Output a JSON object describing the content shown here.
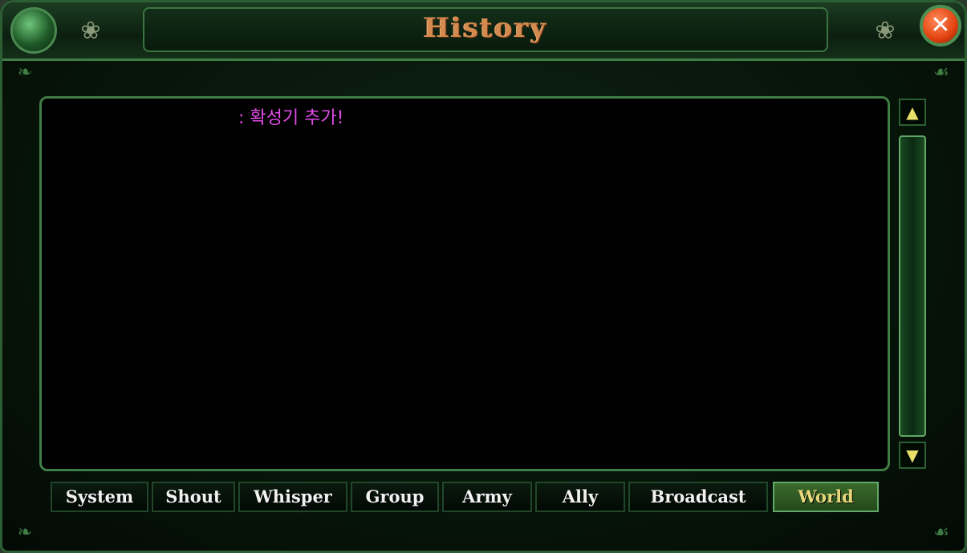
{
  "window": {
    "title": "History",
    "close_symbol": "✕"
  },
  "chat": {
    "lines": [
      {
        "text": ": 확성기 추가!",
        "color": "#e24ce8"
      }
    ]
  },
  "scrollbar": {
    "up_symbol": "▲",
    "down_symbol": "▼"
  },
  "tabs": [
    {
      "label": "System",
      "active": false
    },
    {
      "label": "Shout",
      "active": false
    },
    {
      "label": "Whisper",
      "active": false
    },
    {
      "label": "Group",
      "active": false
    },
    {
      "label": "Army",
      "active": false
    },
    {
      "label": "Ally",
      "active": false
    },
    {
      "label": "Broadcast",
      "active": false
    },
    {
      "label": "World",
      "active": true
    }
  ],
  "colors": {
    "frame_green": "#3f7d45",
    "title_copper": "#d28a4e",
    "active_tab_text": "#e8d87a",
    "chat_magenta": "#e24ce8"
  }
}
